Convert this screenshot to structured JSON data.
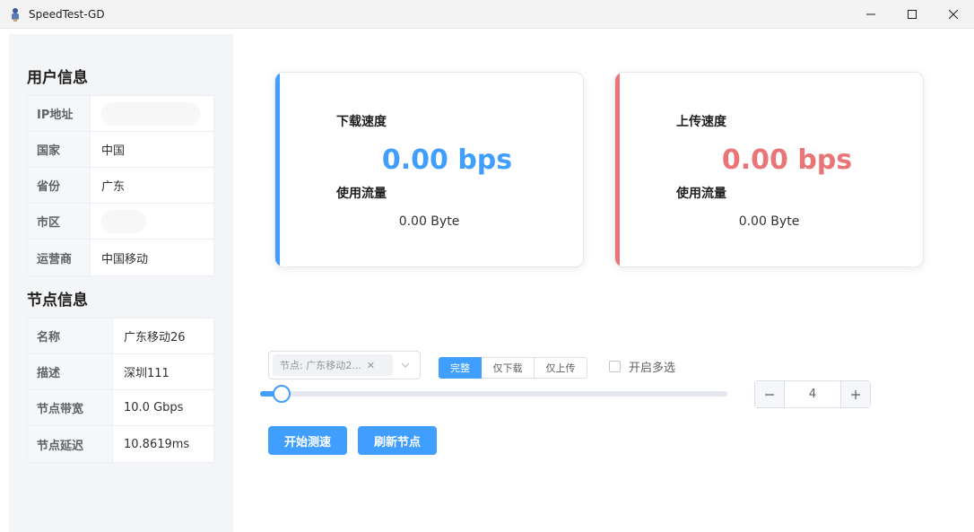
{
  "window": {
    "title": "SpeedTest-GD"
  },
  "sidebar": {
    "user_info_title": "用户信息",
    "user_info": [
      {
        "key": "IP地址",
        "value": ""
      },
      {
        "key": "国家",
        "value": "中国"
      },
      {
        "key": "省份",
        "value": "广东"
      },
      {
        "key": "市区",
        "value": ""
      },
      {
        "key": "运营商",
        "value": "中国移动"
      }
    ],
    "node_info_title": "节点信息",
    "node_info": [
      {
        "key": "名称",
        "value": "广东移动26"
      },
      {
        "key": "描述",
        "value": "深圳111"
      },
      {
        "key": "节点带宽",
        "value": "10.0 Gbps"
      },
      {
        "key": "节点延迟",
        "value": "10.8619ms"
      }
    ]
  },
  "download": {
    "label": "下载速度",
    "speed": "0.00 bps",
    "traffic_label": "使用流量",
    "traffic": "0.00 Byte",
    "color": "#409eff"
  },
  "upload": {
    "label": "上传速度",
    "speed": "0.00 bps",
    "traffic_label": "使用流量",
    "traffic": "0.00 Byte",
    "color": "#e97576"
  },
  "controls": {
    "node_tag": "节点: 广东移动2...",
    "modes": [
      "完整",
      "仅下载",
      "仅上传"
    ],
    "multi_select_label": "开启多选",
    "slider_percent": 4.6,
    "thread_count": "4",
    "start_button": "开始测速",
    "refresh_button": "刷新节点"
  }
}
